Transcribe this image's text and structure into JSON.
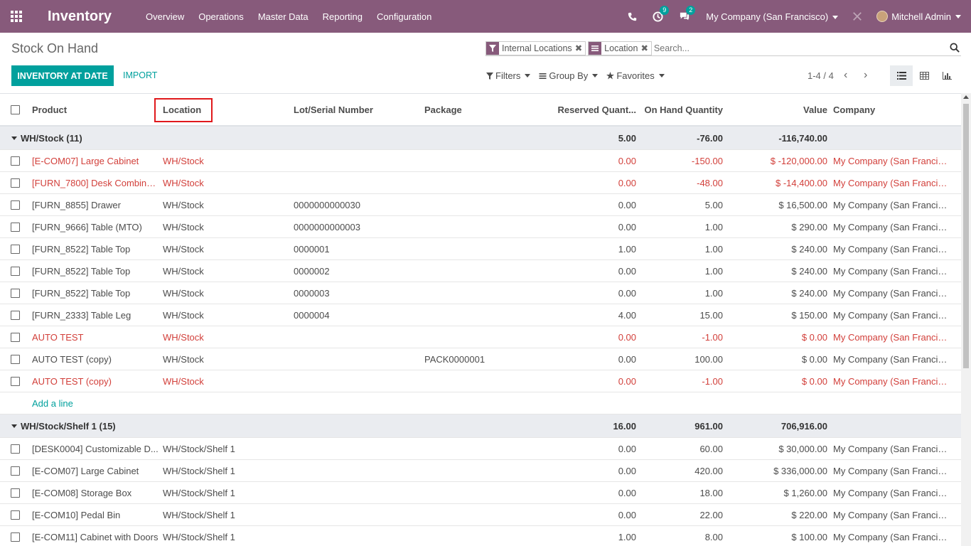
{
  "navbar": {
    "app_title": "Inventory",
    "menus": [
      "Overview",
      "Operations",
      "Master Data",
      "Reporting",
      "Configuration"
    ],
    "activity_count": "9",
    "message_count": "2",
    "company": "My Company (San Francisco)",
    "user": "Mitchell Admin"
  },
  "control": {
    "breadcrumb": "Stock On Hand",
    "primary_button": "INVENTORY AT DATE",
    "import_button": "IMPORT",
    "facets": [
      {
        "label": "Internal Locations",
        "icon": "filter-icon"
      },
      {
        "label": "Location",
        "icon": "group-by-icon"
      }
    ],
    "search_placeholder": "Search...",
    "filters_label": "Filters",
    "groupby_label": "Group By",
    "favorites_label": "Favorites",
    "pager": "1-4 / 4",
    "views": [
      "list-view-icon",
      "pivot-view-icon",
      "graph-view-icon"
    ]
  },
  "table": {
    "headers": {
      "product": "Product",
      "location": "Location",
      "lot": "Lot/Serial Number",
      "package": "Package",
      "reserved": "Reserved Quant...",
      "onhand": "On Hand Quantity",
      "value": "Value",
      "company": "Company"
    },
    "groups": [
      {
        "label": "WH/Stock (11)",
        "reserved": "5.00",
        "onhand": "-76.00",
        "value": "-116,740.00",
        "rows": [
          {
            "product": "[E-COM07] Large Cabinet",
            "location": "WH/Stock",
            "lot": "",
            "package": "",
            "reserved": "0.00",
            "onhand": "-150.00",
            "value": "$ -120,000.00",
            "company": "My Company (San Francis...",
            "negative": true
          },
          {
            "product": "[FURN_7800] Desk Combinat...",
            "location": "WH/Stock",
            "lot": "",
            "package": "",
            "reserved": "0.00",
            "onhand": "-48.00",
            "value": "$ -14,400.00",
            "company": "My Company (San Francis...",
            "negative": true
          },
          {
            "product": "[FURN_8855] Drawer",
            "location": "WH/Stock",
            "lot": "0000000000030",
            "package": "",
            "reserved": "0.00",
            "onhand": "5.00",
            "value": "$ 16,500.00",
            "company": "My Company (San Francis...",
            "negative": false
          },
          {
            "product": "[FURN_9666] Table (MTO)",
            "location": "WH/Stock",
            "lot": "0000000000003",
            "package": "",
            "reserved": "0.00",
            "onhand": "1.00",
            "value": "$ 290.00",
            "company": "My Company (San Francis...",
            "negative": false
          },
          {
            "product": "[FURN_8522] Table Top",
            "location": "WH/Stock",
            "lot": "0000001",
            "package": "",
            "reserved": "1.00",
            "onhand": "1.00",
            "value": "$ 240.00",
            "company": "My Company (San Francis...",
            "negative": false
          },
          {
            "product": "[FURN_8522] Table Top",
            "location": "WH/Stock",
            "lot": "0000002",
            "package": "",
            "reserved": "0.00",
            "onhand": "1.00",
            "value": "$ 240.00",
            "company": "My Company (San Francis...",
            "negative": false
          },
          {
            "product": "[FURN_8522] Table Top",
            "location": "WH/Stock",
            "lot": "0000003",
            "package": "",
            "reserved": "0.00",
            "onhand": "1.00",
            "value": "$ 240.00",
            "company": "My Company (San Francis...",
            "negative": false
          },
          {
            "product": "[FURN_2333] Table Leg",
            "location": "WH/Stock",
            "lot": "0000004",
            "package": "",
            "reserved": "4.00",
            "onhand": "15.00",
            "value": "$ 150.00",
            "company": "My Company (San Francis...",
            "negative": false
          },
          {
            "product": "AUTO TEST",
            "location": "WH/Stock",
            "lot": "",
            "package": "",
            "reserved": "0.00",
            "onhand": "-1.00",
            "value": "$ 0.00",
            "company": "My Company (San Francis...",
            "negative": true
          },
          {
            "product": "AUTO TEST (copy)",
            "location": "WH/Stock",
            "lot": "",
            "package": "PACK0000001",
            "reserved": "0.00",
            "onhand": "100.00",
            "value": "$ 0.00",
            "company": "My Company (San Francis...",
            "negative": false
          },
          {
            "product": "AUTO TEST (copy)",
            "location": "WH/Stock",
            "lot": "",
            "package": "",
            "reserved": "0.00",
            "onhand": "-1.00",
            "value": "$ 0.00",
            "company": "My Company (San Francis...",
            "negative": true
          }
        ],
        "add_line": "Add a line"
      },
      {
        "label": "WH/Stock/Shelf 1 (15)",
        "reserved": "16.00",
        "onhand": "961.00",
        "value": "706,916.00",
        "rows": [
          {
            "product": "[DESK0004] Customizable D...",
            "location": "WH/Stock/Shelf 1",
            "lot": "",
            "package": "",
            "reserved": "0.00",
            "onhand": "60.00",
            "value": "$ 30,000.00",
            "company": "My Company (San Francis...",
            "negative": false
          },
          {
            "product": "[E-COM07] Large Cabinet",
            "location": "WH/Stock/Shelf 1",
            "lot": "",
            "package": "",
            "reserved": "0.00",
            "onhand": "420.00",
            "value": "$ 336,000.00",
            "company": "My Company (San Francis...",
            "negative": false
          },
          {
            "product": "[E-COM08] Storage Box",
            "location": "WH/Stock/Shelf 1",
            "lot": "",
            "package": "",
            "reserved": "0.00",
            "onhand": "18.00",
            "value": "$ 1,260.00",
            "company": "My Company (San Francis...",
            "negative": false
          },
          {
            "product": "[E-COM10] Pedal Bin",
            "location": "WH/Stock/Shelf 1",
            "lot": "",
            "package": "",
            "reserved": "0.00",
            "onhand": "22.00",
            "value": "$ 220.00",
            "company": "My Company (San Francis...",
            "negative": false
          },
          {
            "product": "[E-COM11] Cabinet with Doors",
            "location": "WH/Stock/Shelf 1",
            "lot": "",
            "package": "",
            "reserved": "1.00",
            "onhand": "8.00",
            "value": "$ 100.00",
            "company": "My Company (San Francis...",
            "negative": false
          }
        ]
      }
    ]
  },
  "colors": {
    "brand": "#875a7b",
    "accent": "#00a09d",
    "danger": "#d23f3a",
    "highlight_box": "#e0191c"
  }
}
